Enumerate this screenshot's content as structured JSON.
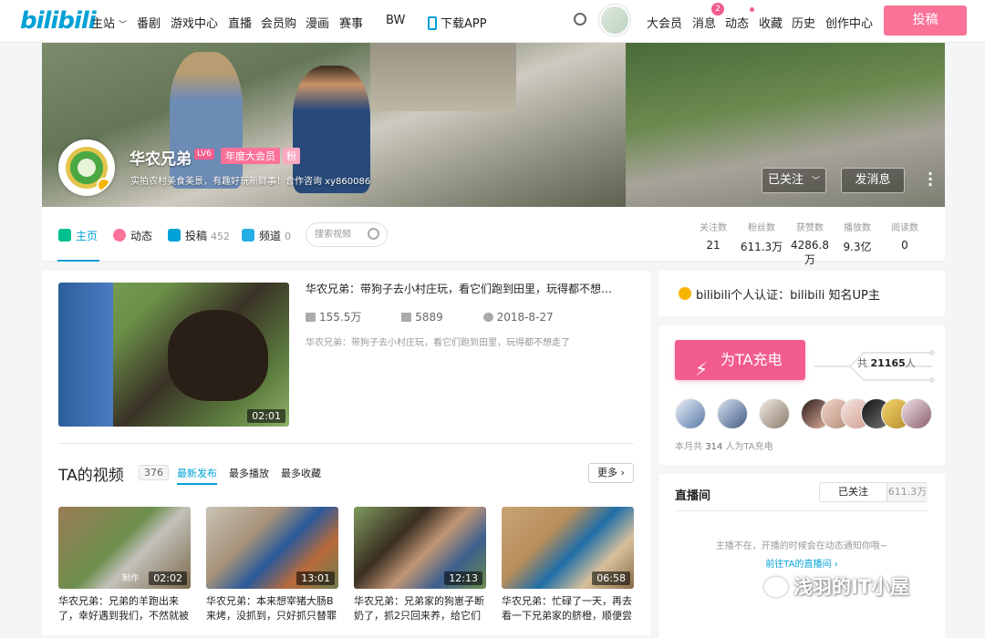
{
  "nav": {
    "logo": "bilibili",
    "items": [
      "主站",
      "番剧",
      "游戏中心",
      "直播",
      "会员购",
      "漫画",
      "赛事",
      "BW",
      "下载APP"
    ],
    "right_items": [
      "大会员",
      "消息",
      "动态",
      "收藏",
      "历史",
      "创作中心"
    ],
    "msg_badge": "2",
    "submit_label": "投稿"
  },
  "profile": {
    "name": "华农兄弟",
    "level": "LV6",
    "vip": "年度大会员",
    "fan_tag": "粉",
    "sign": "实拍农村美食美景，有趣好玩新鲜事！合作咨询 xy860086",
    "followed_label": "已关注",
    "message_label": "发消息"
  },
  "tabs": {
    "home": "主页",
    "dynamic": "动态",
    "submit": "投稿",
    "submit_count": "452",
    "channel": "频道",
    "channel_count": "0",
    "search_placeholder": "搜索视频"
  },
  "stats": [
    {
      "label": "关注数",
      "value": "21"
    },
    {
      "label": "粉丝数",
      "value": "611.3万"
    },
    {
      "label": "获赞数",
      "value": "4286.8万"
    },
    {
      "label": "播放数",
      "value": "9.3亿"
    },
    {
      "label": "阅读数",
      "value": "0"
    }
  ],
  "featured": {
    "title": "华农兄弟：带狗子去小村庄玩，看它们跑到田里，玩得都不想…",
    "views": "155.5万",
    "danmaku": "5889",
    "date": "2018-8-27",
    "desc": "华农兄弟：带狗子去小村庄玩，看它们跑到田里，玩得都不想走了",
    "duration": "02:01"
  },
  "videos": {
    "heading": "TA的视频",
    "count": "376",
    "sort_new": "最新发布",
    "sort_play": "最多播放",
    "sort_fav": "最多收藏",
    "more": "更多",
    "items": [
      {
        "title": "华农兄弟：兄弟的羊跑出来了，幸好遇到我们，不然就被",
        "duration": "02:02",
        "thumb_tag": "制作"
      },
      {
        "title": "华农兄弟：本来想宰猪大肠B来烤，没抓到，只好抓只替罪",
        "duration": "13:01"
      },
      {
        "title": "华农兄弟：兄弟家的狗崽子断奶了，抓2只回来养，给它们",
        "duration": "12:13"
      },
      {
        "title": "华农兄弟：忙碌了一天，再去看一下兄弟家的脐橙，顺便尝",
        "duration": "06:58"
      }
    ]
  },
  "auth": {
    "text": "bilibili个人认证：bilibili 知名UP主"
  },
  "charge": {
    "button": "为TA充电",
    "total_prefix": "共",
    "total": "21165",
    "total_suffix": "人",
    "month_prefix": "本月共",
    "month_count": "314",
    "month_suffix": "人为TA充电"
  },
  "live": {
    "title": "直播间",
    "followed": "已关注",
    "fans": "611.3万",
    "offline": "主播不在，开播的时候会在动态通知你哦~",
    "goto": "前往TA的直播间"
  },
  "watermark": "浅羽的IT小屋",
  "colors": {
    "accent": "#00a1d6",
    "pink": "#fb7299"
  }
}
